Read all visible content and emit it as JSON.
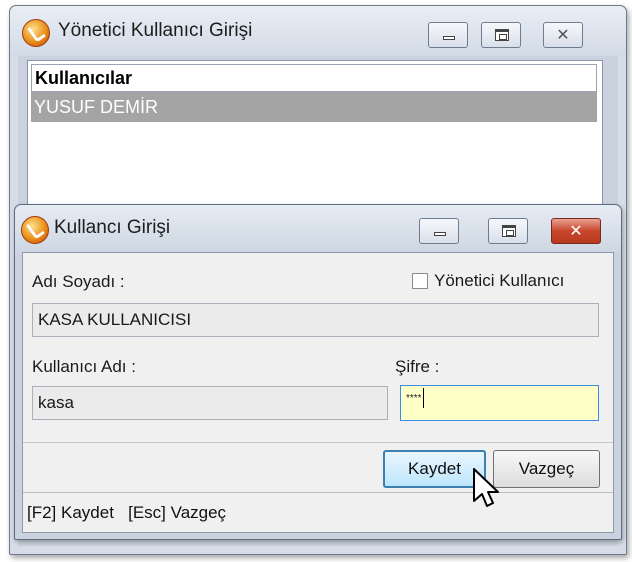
{
  "outer_window": {
    "title": "Yönetici Kullanıcı Girişi",
    "list": {
      "header": "Kullanıcılar",
      "rows": [
        "YUSUF DEMİR"
      ]
    }
  },
  "dialog": {
    "title": "Kullancı Girişi",
    "full_name_label": "Adı Soyadı :",
    "full_name_value": "KASA KULLANICISI",
    "admin_checkbox_label": "Yönetici Kullanıcı",
    "admin_checked": false,
    "username_label": "Kullanıcı Adı :",
    "username_value": "kasa",
    "password_label": "Şifre :",
    "password_value": "****",
    "save_button": "Kaydet",
    "cancel_button": "Vazgeç",
    "status_text": "[F2] Kaydet   [Esc] Vazgeç"
  },
  "icons": {
    "app": "app-logo-icon",
    "minimize": "minimize-icon",
    "maximize": "maximize-icon",
    "close": "close-icon",
    "cursor": "mouse-pointer-icon"
  },
  "colors": {
    "selected_row": "#a4a4a4",
    "password_bg": "#ffffc8",
    "close_button_red": "#c8472c"
  }
}
